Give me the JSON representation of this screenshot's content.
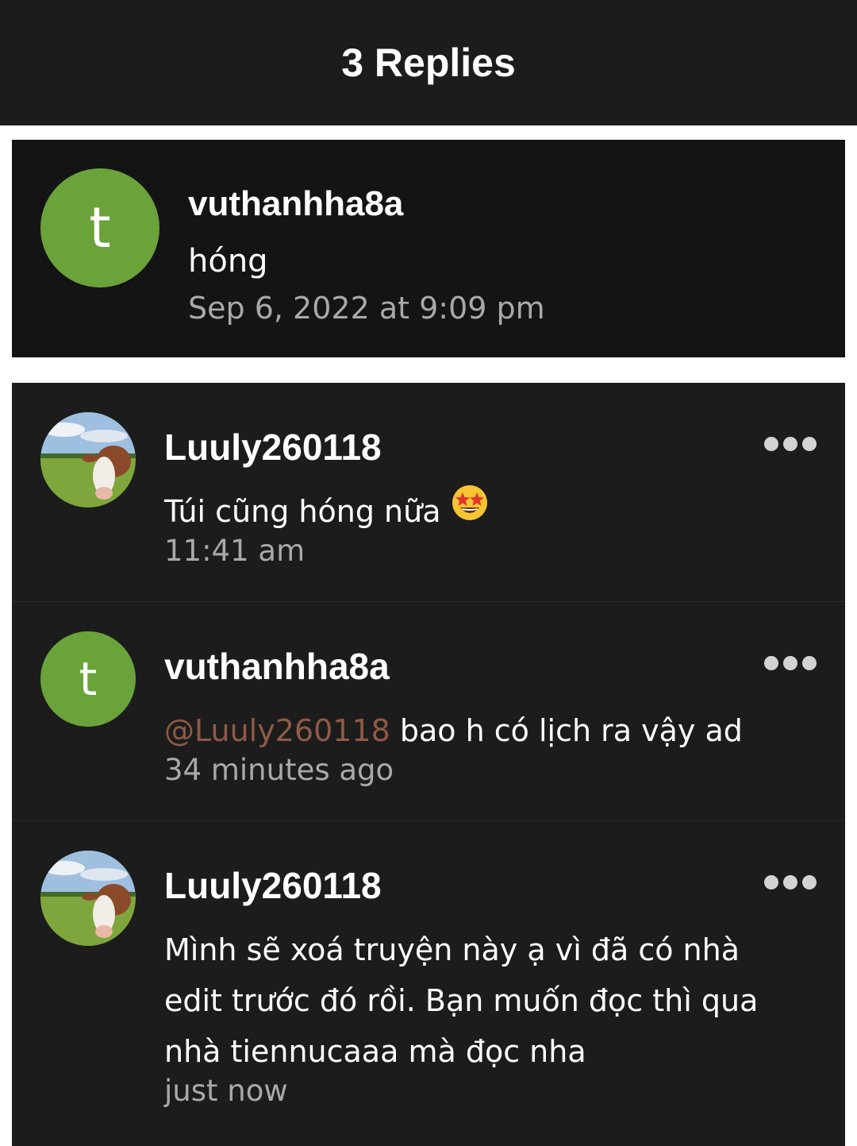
{
  "header": {
    "title": "3 Replies"
  },
  "parent_comment": {
    "avatar_letter": "t",
    "username": "vuthanhha8a",
    "text": "hóng",
    "time": "Sep 6, 2022 at 9:09 pm"
  },
  "replies": [
    {
      "username": "Luuly260118",
      "avatar": "cow-photo",
      "text": "Túi cũng hóng nữa",
      "emoji": "star-struck",
      "time": "11:41 am"
    },
    {
      "username": "vuthanhha8a",
      "avatar_letter": "t",
      "mention": "@Luuly260118",
      "text": " bao h có lịch ra vậy ad",
      "time": "34 minutes ago"
    },
    {
      "username": "Luuly260118",
      "avatar": "cow-photo",
      "text": "Mình sẽ xoá truyện này ạ vì đã có nhà edit trước đó rồi. Bạn muốn đọc thì qua nhà tiennucaaa mà đọc nha",
      "time": "just now"
    }
  ]
}
